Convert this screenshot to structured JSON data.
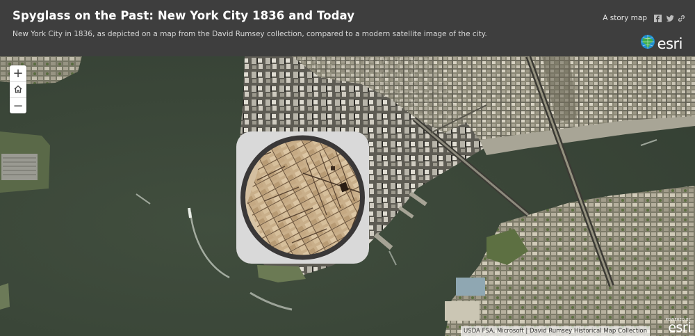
{
  "header": {
    "title": "Spyglass on the Past: New York City 1836 and Today",
    "subtitle": "New York City in 1836, as depicted on a map from the David Rumsey collection, compared to a modern satellite image of the city.",
    "story_map_label": "A story map",
    "share_icons": [
      "facebook-icon",
      "twitter-icon",
      "link-icon"
    ],
    "brand_word": "esri"
  },
  "zoom": {
    "zoom_in": "+",
    "home_icon": "home-icon",
    "zoom_out": "−"
  },
  "attribution": {
    "text": "USDA FSA, Microsoft | David Rumsey Historical Map Collection"
  },
  "powered_by": {
    "small": "POWERED BY",
    "big": "esri"
  },
  "colors": {
    "header_bg": "#3e3e3e",
    "water": "#3c4a3a",
    "spyglass_panel": "#d9d9d9",
    "spyglass_ring": "#3a3838",
    "old_map": "#c8ad88"
  }
}
